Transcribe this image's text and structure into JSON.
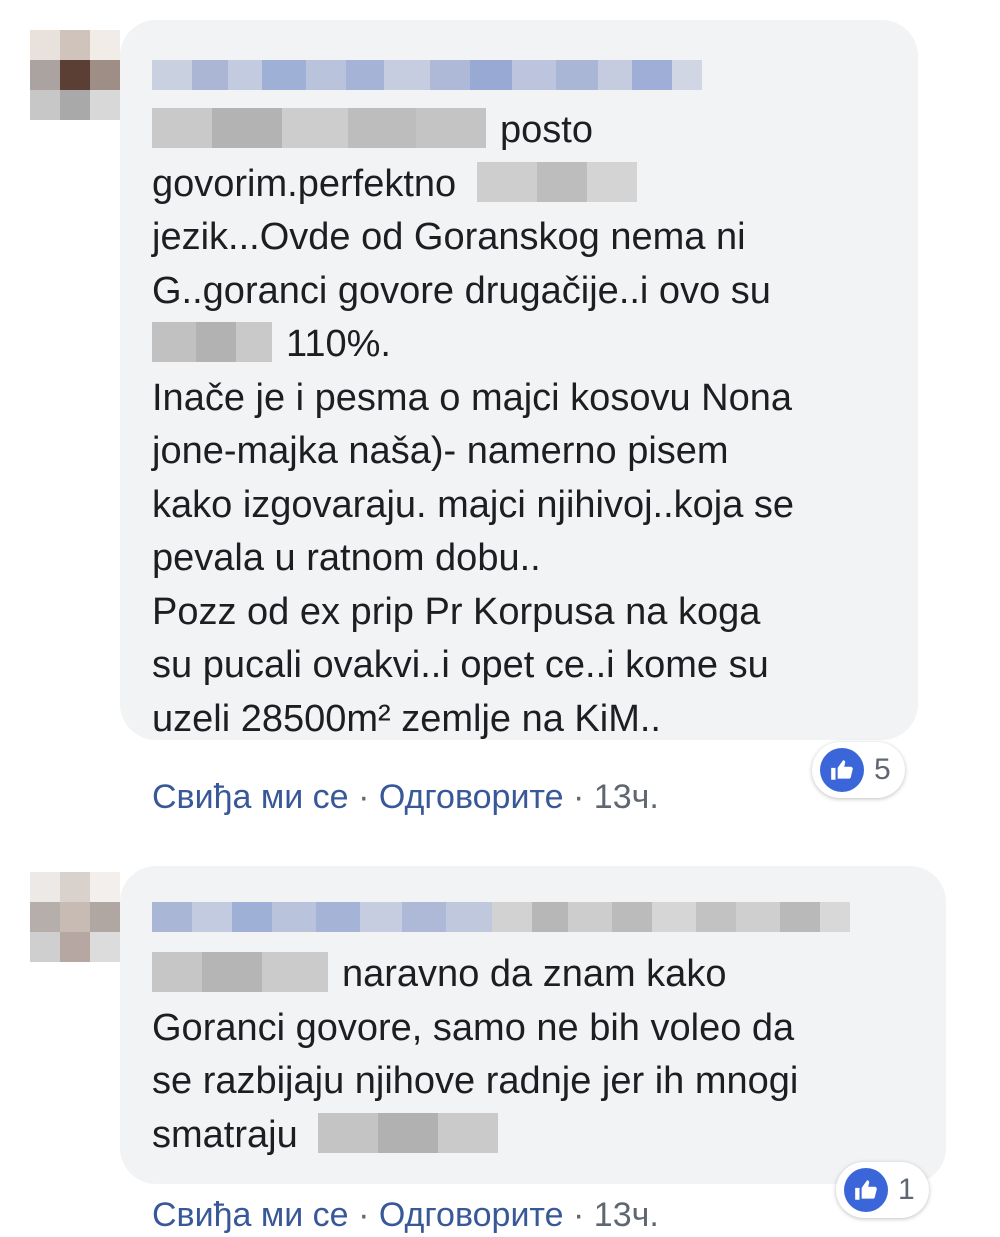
{
  "comments": [
    {
      "lines": [
        "posto",
        "govorim.perfektno",
        "jezik...Ovde od Goranskog nema ni",
        "G..goranci govore drugačije..i ovo su",
        "110%.",
        "Inače je i pesma o majci kosovu Nona",
        "jone-majka naša)- namerno pisem",
        "kako izgovaraju. majci njihivoj..koja se",
        "pevala u ratnom dobu..",
        "Pozz od ex prip Pr Korpusa na koga",
        "su pucali ovakvi..i opet ce..i kome su",
        "uzeli 28500m² zemlje na KiM.."
      ],
      "actions": {
        "like": "Свиђа ми се",
        "sep": "·",
        "reply": "Одговорите",
        "time": "13ч."
      },
      "reaction_count": "5",
      "colors": {
        "bubble": "#f2f3f5",
        "link": "#385898",
        "like_icon": "#3b66d9"
      }
    },
    {
      "lines": [
        "naravno da znam kako",
        "Goranci govore, samo ne bih voleo da",
        "se razbijaju njihove radnje jer ih mnogi",
        "smatraju"
      ],
      "actions": {
        "like": "Свиђа ми се",
        "sep": "·",
        "reply": "Одговорите",
        "time": "13ч."
      },
      "reaction_count": "1",
      "colors": {
        "bubble": "#f2f3f5",
        "link": "#385898",
        "like_icon": "#3b66d9"
      }
    }
  ]
}
